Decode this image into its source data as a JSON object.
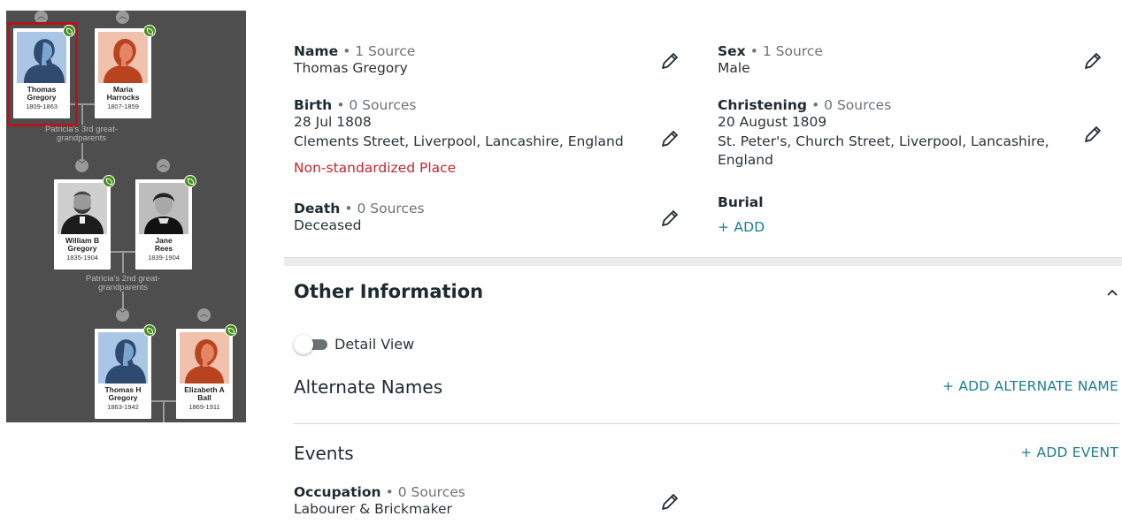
{
  "tree": {
    "persons": [
      {
        "name": "Thomas Gregory",
        "line1": "Thomas",
        "line2": "Gregory",
        "dates": "1809-1863",
        "gender": "male"
      },
      {
        "name": "Maria Harrocks",
        "line1": "Maria",
        "line2": "Harrocks",
        "dates": "1807-1859",
        "gender": "female"
      },
      {
        "name": "William B Gregory",
        "line1": "William B",
        "line2": "Gregory",
        "dates": "1835-1904",
        "gender": "photo-male"
      },
      {
        "name": "Jane Rees",
        "line1": "Jane",
        "line2": "Rees",
        "dates": "1839-1904",
        "gender": "photo-female"
      },
      {
        "name": "Thomas H Gregory",
        "line1": "Thomas H",
        "line2": "Gregory",
        "dates": "1863-1942",
        "gender": "male"
      },
      {
        "name": "Elizabeth A Ball",
        "line1": "Elizabeth A",
        "line2": "Ball",
        "dates": "1869-1911",
        "gender": "female"
      }
    ],
    "gen3_line1": "Patricia's 3rd great-",
    "gen3_line2": "grandparents",
    "gen2_line1": "Patricia's 2nd great-",
    "gen2_line2": "grandparents",
    "colors": {
      "background": "#4e4e4e",
      "selected": "#b3151a",
      "leaf": "#4a8f1f"
    }
  },
  "facts": {
    "name": {
      "label": "Name",
      "sources": "• 1 Source",
      "value": "Thomas Gregory"
    },
    "sex": {
      "label": "Sex",
      "sources": "• 1 Source",
      "value": "Male"
    },
    "birth": {
      "label": "Birth",
      "sources": "• 0 Sources",
      "date": "28 Jul 1808",
      "place": "Clements Street, Liverpool, Lancashire, England",
      "warning": "Non-standardized Place"
    },
    "christening": {
      "label": "Christening",
      "sources": "• 0 Sources",
      "date": "20 August 1809",
      "place1": "St. Peter's, Church Street, Liverpool, Lancashire,",
      "place2": "England"
    },
    "death": {
      "label": "Death",
      "sources": "• 0 Sources",
      "value": "Deceased"
    },
    "burial": {
      "label": "Burial",
      "add": "+  ADD"
    }
  },
  "other": {
    "title": "Other Information",
    "collapse_icon": "chevron-up-icon",
    "detail_view": "Detail View",
    "alternate_names": "Alternate Names",
    "add_alternate_name": "+  ADD ALTERNATE NAME",
    "events": "Events",
    "add_event": "+  ADD EVENT",
    "occupation": {
      "label": "Occupation",
      "sources": "• 0 Sources",
      "value": "Labourer & Brickmaker"
    }
  },
  "accent": "#1c7d8e"
}
